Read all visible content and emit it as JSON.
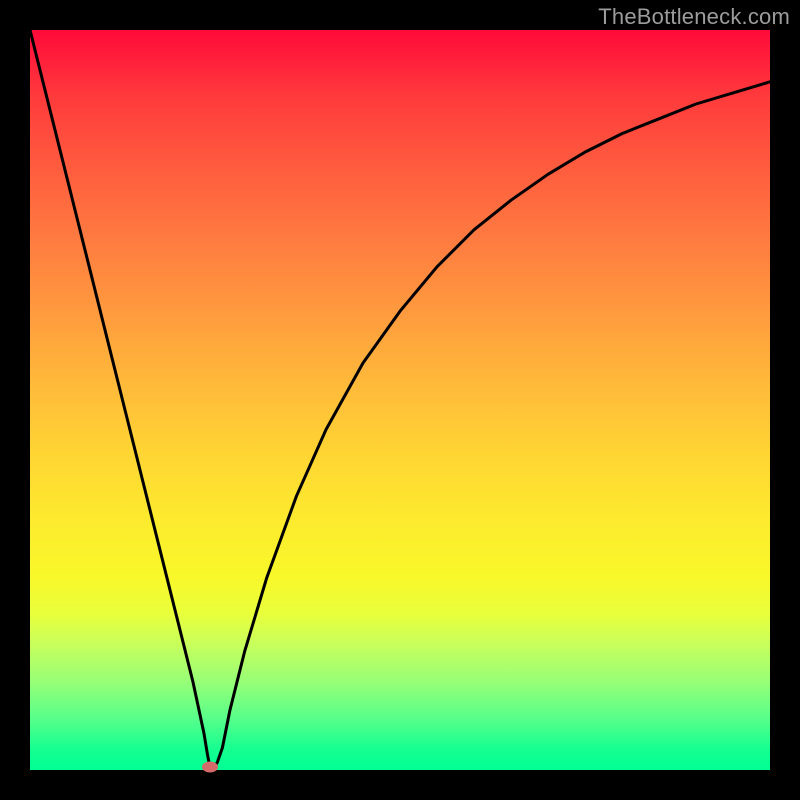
{
  "watermark": "TheBottleneck.com",
  "chart_data": {
    "type": "line",
    "title": "",
    "xlabel": "",
    "ylabel": "",
    "xlim": [
      0,
      100
    ],
    "ylim": [
      0,
      100
    ],
    "grid": false,
    "legend": false,
    "series": [
      {
        "name": "bottleneck-curve",
        "x": [
          0,
          2,
          5,
          8,
          11,
          14,
          17,
          20,
          22,
          23.5,
          24,
          24.3,
          24.8,
          25.3,
          26,
          27,
          29,
          32,
          36,
          40,
          45,
          50,
          55,
          60,
          65,
          70,
          75,
          80,
          85,
          90,
          95,
          100
        ],
        "y": [
          100,
          92,
          80,
          68,
          56,
          44,
          32,
          20,
          12,
          5,
          2,
          0.5,
          0.3,
          1,
          3,
          8,
          16,
          26,
          37,
          46,
          55,
          62,
          68,
          73,
          77,
          80.5,
          83.5,
          86,
          88,
          90,
          91.5,
          93
        ],
        "color": "#000000"
      }
    ],
    "annotations": [
      {
        "type": "marker",
        "x": 24.3,
        "y": 0.4,
        "shape": "ellipse",
        "color": "#d46a6a"
      }
    ],
    "background_gradient": {
      "direction": "vertical",
      "stops": [
        {
          "pos": 0.0,
          "color": "#ff0a3a"
        },
        {
          "pos": 0.5,
          "color": "#ffc536"
        },
        {
          "pos": 0.75,
          "color": "#f8f82a"
        },
        {
          "pos": 1.0,
          "color": "#00ff94"
        }
      ]
    }
  }
}
